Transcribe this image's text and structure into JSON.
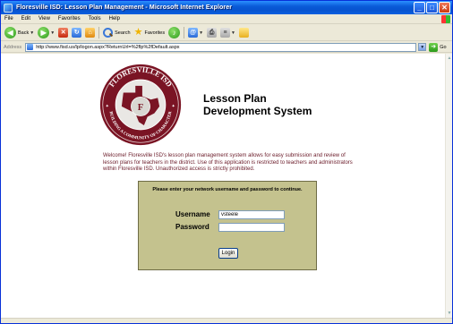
{
  "window": {
    "title": "Floresville ISD: Lesson Plan Management - Microsoft Internet Explorer",
    "controls": {
      "minimize": "_",
      "maximize": "□",
      "close": "✕"
    }
  },
  "menu": [
    "File",
    "Edit",
    "View",
    "Favorites",
    "Tools",
    "Help"
  ],
  "toolbar": {
    "back_label": "Back",
    "search_label": "Search",
    "favorites_label": "Favorites"
  },
  "address": {
    "label": "Address",
    "url": "http://www.fisd.us/lp/logon.aspx?ReturnUrl=%2flp%2fDefault.aspx",
    "go_label": "Go"
  },
  "logo": {
    "arc_top": "FLORESVILLE ISD",
    "arc_bottom": "BUILDING A COMMUNITY OF CHARACTER",
    "center_letter": "F"
  },
  "page": {
    "heading_line1": "Lesson Plan",
    "heading_line2": "Development System",
    "welcome": "Welcome! Floresville ISD's lesson plan management system allows for easy submission and review of lesson plans for teachers in the district. Use of this application is restricted to teachers and administrators within Floresville ISD. Unauthorized access is strictly prohibited."
  },
  "login": {
    "prompt": "Please enter your network username and password to continue.",
    "username_label": "Username",
    "username_value": "vsteele",
    "password_label": "Password",
    "password_value": "",
    "button_label": "Login"
  },
  "colors": {
    "welcome_text": "#6a1a28",
    "panel_bg": "#c4c28e",
    "logo_maroon": "#7a1424"
  }
}
